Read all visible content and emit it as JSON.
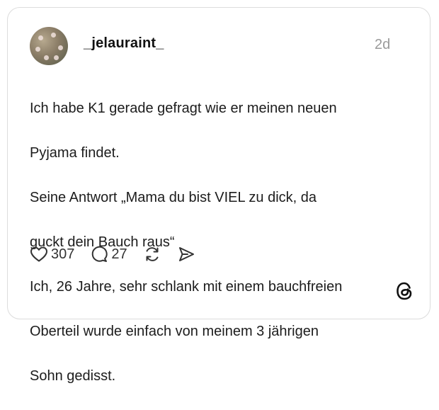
{
  "post": {
    "username": "_jelauraint_",
    "time": "2d",
    "text_lines": [
      "Ich habe K1 gerade gefragt wie er meinen neuen",
      "Pyjama findet.",
      "Seine Antwort „Mama du bist VIEL zu dick, da",
      "guckt dein Bauch raus“",
      "Ich, 26 Jahre, sehr schlank mit einem bauchfreien",
      "Oberteil wurde einfach von meinem 3 jährigen",
      "Sohn gedisst."
    ]
  },
  "actions": {
    "like_count": "307",
    "reply_count": "27"
  },
  "icons": {
    "like": "heart-icon",
    "reply": "speech-bubble-icon",
    "repost": "repost-icon",
    "share": "send-icon",
    "brand": "threads-logo-icon"
  }
}
